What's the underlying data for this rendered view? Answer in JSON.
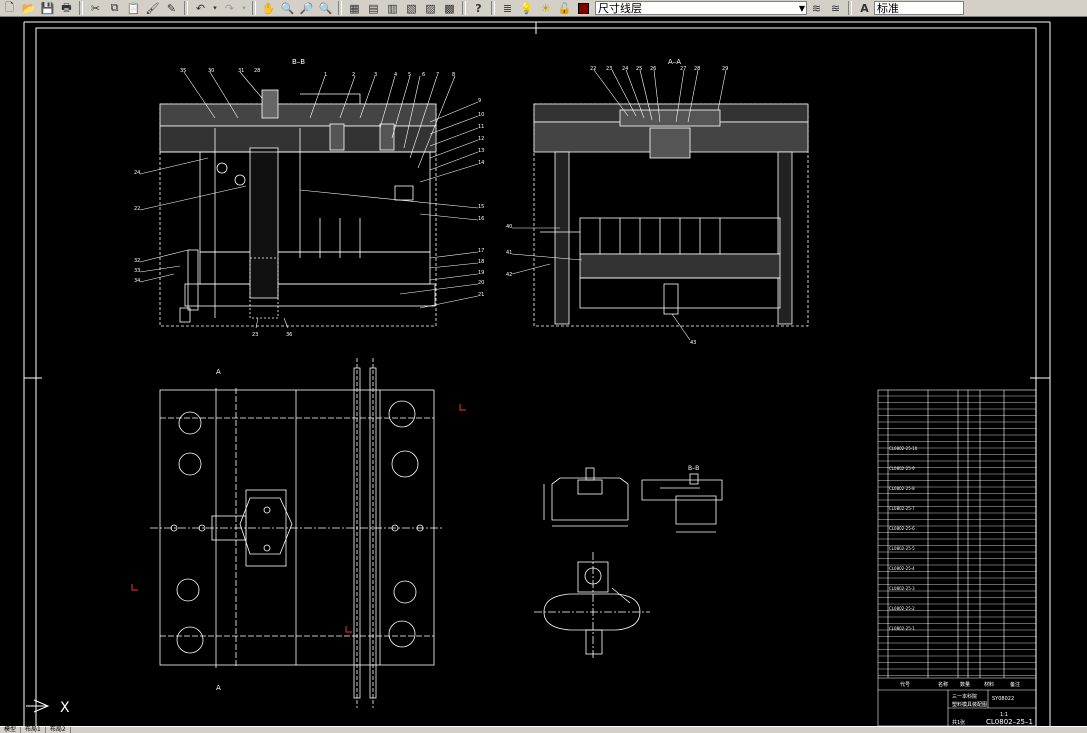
{
  "toolbar": {
    "layer_name": "尺寸线层",
    "text_style": "标准",
    "colors": {
      "layer_swatch": "#800000",
      "bg": "#d4d0c8"
    }
  },
  "drawing": {
    "view_bb_label": "B–B",
    "view_aa_label": "A–A",
    "detail_bb_label": "B–B",
    "section_mark_a": "A",
    "drawing_number": "CL0802–25–1",
    "sheet_info": "共1张",
    "scale": "1:1",
    "material_code": "SY08022",
    "title_school": "三一本科院",
    "title_name": "塑料模具装配图",
    "bom_header_code": "代号",
    "bom_header_name": "名称",
    "bom_header_qty": "数量",
    "bom_header_material": "材料",
    "bom_header_remark": "备注",
    "part_numbers_bb": [
      "35",
      "30",
      "31",
      "28",
      "1",
      "2",
      "3",
      "4",
      "5",
      "6",
      "7",
      "8",
      "9",
      "10",
      "11",
      "12",
      "13",
      "14",
      "15",
      "16",
      "17",
      "18",
      "19",
      "20",
      "21",
      "32",
      "33",
      "34",
      "24",
      "22",
      "23",
      "36"
    ],
    "part_numbers_aa": [
      "22",
      "23",
      "24",
      "25",
      "26",
      "27",
      "28",
      "29",
      "40",
      "41",
      "42",
      "43"
    ],
    "bom_codes": [
      "CL0802-25-10",
      "CL0802-25-9",
      "CL0802-25-8",
      "CL0802-25-7",
      "CL0802-25-6",
      "CL0802-25-5",
      "CL0802-25-4",
      "CL0802-25-3",
      "CL0802-25-2",
      "CL0802-25-1"
    ],
    "ucs_label": "X"
  },
  "status": {
    "tabs": [
      "模型",
      "布局1",
      "布局2"
    ]
  }
}
